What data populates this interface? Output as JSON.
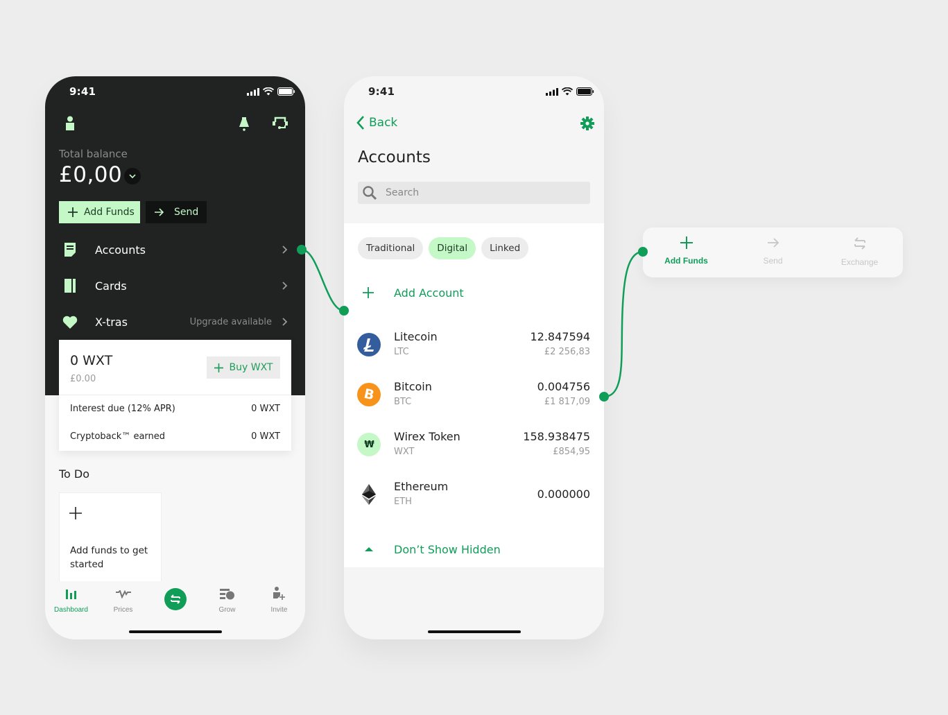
{
  "colors": {
    "accent": "#0f9d58",
    "mint": "#c5f8c7",
    "dark": "#212323",
    "background": "#ededed"
  },
  "dashboard": {
    "status_time": "9:41",
    "status_icons": [
      "signal-icon",
      "wifi-icon",
      "battery-icon"
    ],
    "top_icons": [
      "profile-icon",
      "bell-icon",
      "support-headset-icon"
    ],
    "total_balance_label": "Total balance",
    "total_balance_value": "£0,00",
    "buttons": {
      "add_funds": "Add Funds",
      "send": "Send"
    },
    "menu": [
      {
        "label": "Accounts",
        "icon": "accounts-icon",
        "extra": ""
      },
      {
        "label": "Cards",
        "icon": "cards-icon",
        "extra": ""
      },
      {
        "label": "X-tras",
        "icon": "heart-icon",
        "extra": "Upgrade available"
      }
    ],
    "wxt_card": {
      "amount": "0 WXT",
      "fiat": "£0.00",
      "buy_label": "Buy WXT",
      "rows": [
        {
          "label": "Interest due (12% APR)",
          "value": "0 WXT"
        },
        {
          "label": "Cryptoback™ earned",
          "value": "0 WXT"
        }
      ]
    },
    "todo": {
      "title": "To Do",
      "card_text": "Add funds to get started"
    },
    "tabbar": [
      {
        "label": "Dashboard",
        "icon": "dashboard-bars-icon",
        "active": true
      },
      {
        "label": "Prices",
        "icon": "prices-pulse-icon",
        "active": false
      },
      {
        "label": "",
        "icon": "exchange-icon",
        "active": false
      },
      {
        "label": "Grow",
        "icon": "grow-icon",
        "active": false
      },
      {
        "label": "Invite",
        "icon": "invite-user-icon",
        "active": false
      }
    ]
  },
  "accounts_screen": {
    "status_time": "9:41",
    "back_label": "Back",
    "title": "Accounts",
    "search_placeholder": "Search",
    "search_value": "",
    "filters": [
      {
        "label": "Traditional",
        "active": false
      },
      {
        "label": "Digital",
        "active": true
      },
      {
        "label": "Linked",
        "active": false
      }
    ],
    "add_account_label": "Add Account",
    "coins": [
      {
        "name": "Litecoin",
        "symbol": "LTC",
        "amount": "12.847594",
        "fiat": "£2 256,83",
        "icon": "litecoin-icon",
        "color": "#345d9d"
      },
      {
        "name": "Bitcoin",
        "symbol": "BTC",
        "amount": "0.004756",
        "fiat": "£1 817,09",
        "icon": "bitcoin-icon",
        "color": "#f7931a"
      },
      {
        "name": "Wirex Token",
        "symbol": "WXT",
        "amount": "158.938475",
        "fiat": "£854,95",
        "icon": "wirex-token-icon",
        "color": "#c5f8c7"
      },
      {
        "name": "Ethereum",
        "symbol": "ETH",
        "amount": "0.000000",
        "fiat": "",
        "icon": "ethereum-icon",
        "color": "#222222"
      }
    ],
    "hidden_toggle_label": "Don’t Show Hidden"
  },
  "action_sheet": {
    "items": [
      {
        "label": "Add Funds",
        "icon": "plus-icon",
        "active": true
      },
      {
        "label": "Send",
        "icon": "arrow-right-icon",
        "active": false
      },
      {
        "label": "Exchange",
        "icon": "exchange-icon",
        "active": false
      }
    ]
  }
}
